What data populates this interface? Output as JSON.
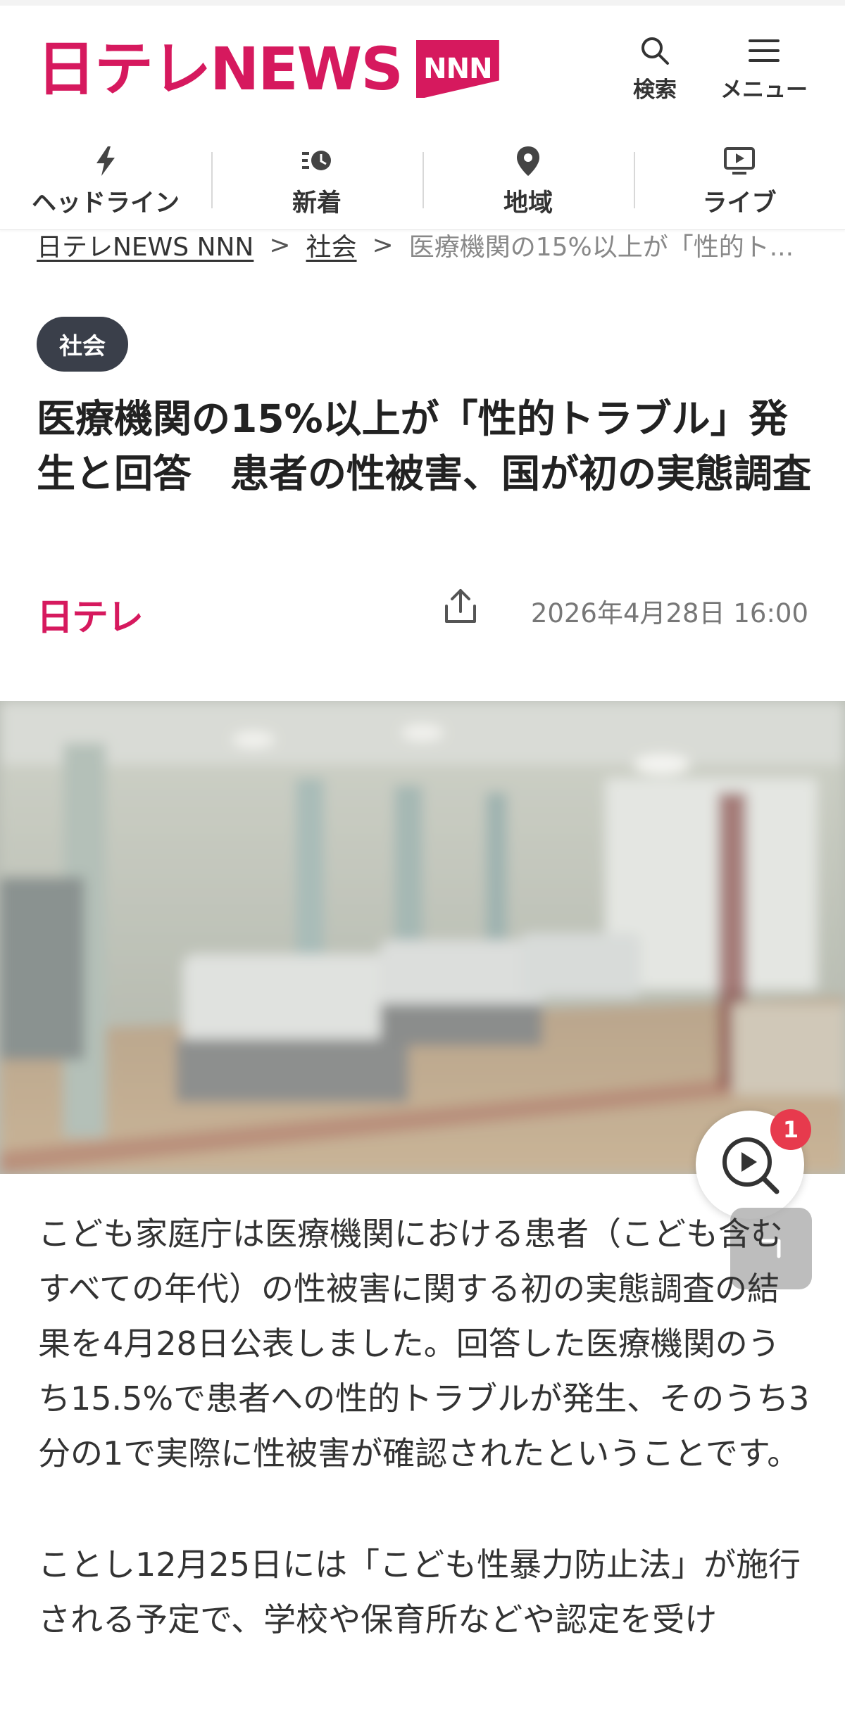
{
  "header": {
    "logo_main": "日テレNEWS",
    "logo_badge": "NNN",
    "search_label": "検索",
    "menu_label": "メニュー"
  },
  "nav": {
    "items": [
      {
        "label": "ヘッドライン",
        "icon": "flash-icon"
      },
      {
        "label": "新着",
        "icon": "clock-icon"
      },
      {
        "label": "地域",
        "icon": "map-pin-icon"
      },
      {
        "label": "ライブ",
        "icon": "play-screen-icon"
      }
    ]
  },
  "breadcrumb": {
    "home": "日テレNEWS NNN",
    "separator": ">",
    "category": "社会",
    "current": "医療機関の15%以上が「性的ト..."
  },
  "article": {
    "category": "社会",
    "title": "医療機関の15%以上が「性的トラブル」発生と回答　患者の性被害、国が初の実態調査",
    "source": "日テレ",
    "date": "2026年4月28日 16:00",
    "paragraphs": [
      "こども家庭庁は医療機関における患者（こども含むすべての年代）の性被害に関する初の実態調査の結果を4月28日公表しました。回答した医療機関のうち15.5%で患者への性的トラブルが発生、そのうち3分の1で実際に性被害が確認されたということです。",
      "ことし12月25日には「こども性暴力防止法」が施行される予定で、学校や保育所などや認定を受け"
    ]
  },
  "player": {
    "badge_count": "1"
  },
  "colors": {
    "brand": "#d6195e",
    "badge_bg": "#3a3f4a",
    "notification": "#e73a4d"
  }
}
